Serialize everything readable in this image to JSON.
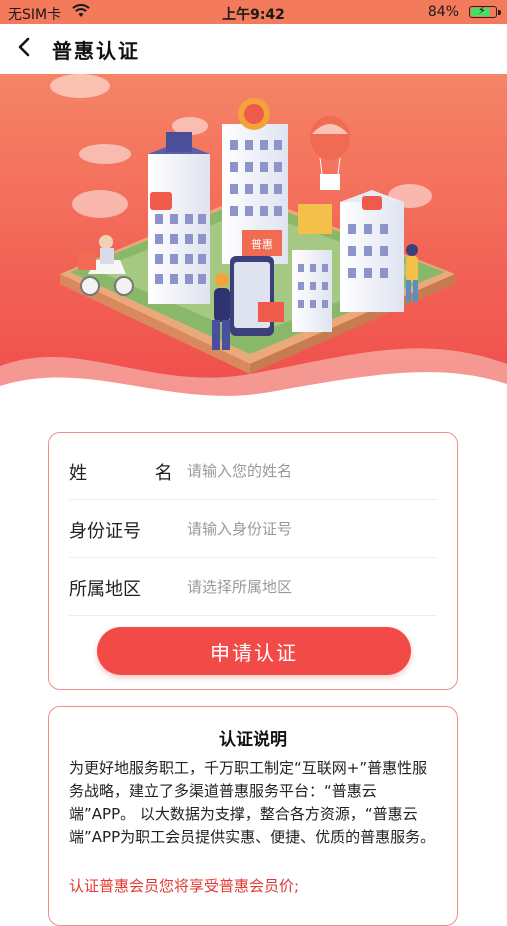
{
  "status_bar": {
    "carrier": "无SIM卡",
    "time": "上午9:42",
    "battery_percent": "84%",
    "battery_level": 0.84
  },
  "nav": {
    "title": "普惠认证",
    "back_icon": "chevron-left-icon"
  },
  "banner": {
    "sign_text": "普惠"
  },
  "form": {
    "fields": [
      {
        "label": "姓    名",
        "placeholder": "请输入您的姓名"
      },
      {
        "label": "身份证号",
        "placeholder": "请输入身份证号"
      },
      {
        "label": "所属地区",
        "placeholder": "请选择所属地区"
      }
    ],
    "submit_label": "申请认证"
  },
  "info": {
    "heading": "认证说明",
    "body": "为更好地服务职工，千万职工制定“互联网+”普惠性服务战略，建立了多渠道普惠服务平台：“普惠云端”APP。 以大数据为支撑，整合各方资源，“普惠云端”APP为职工会员提供实惠、便捷、优质的普惠服务。",
    "note": "认证普惠会员您将享受普惠会员价;"
  },
  "colors": {
    "accent": "#f24b47",
    "banner_top": "#f47a5c",
    "card_border": "#f08e8e"
  }
}
